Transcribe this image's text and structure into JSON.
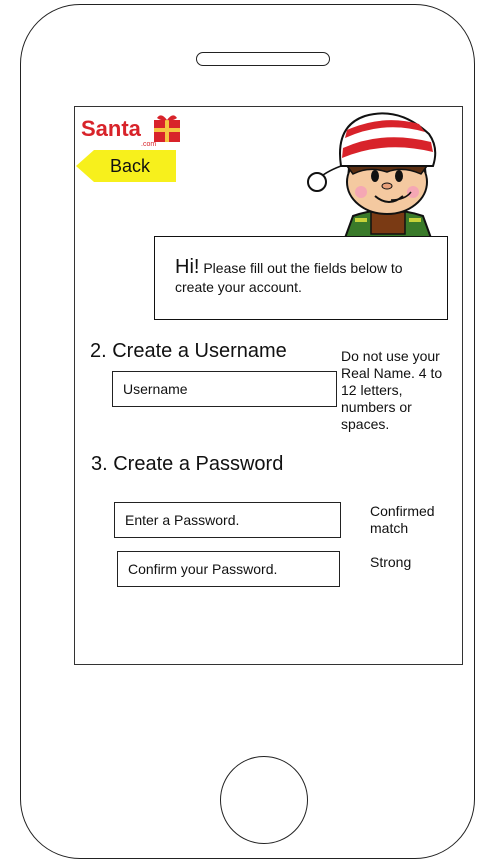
{
  "header": {
    "logo_text": "Santa",
    "logo_sub": ".com",
    "back_label": "Back"
  },
  "bubble": {
    "greeting": "Hi!",
    "message": "Please fill out the fields below to create your account."
  },
  "username_section": {
    "heading": "2. Create a Username",
    "input_placeholder": "Username",
    "hint": "Do not use your Real Name. 4 to 12 letters, numbers or spaces."
  },
  "password_section": {
    "heading": "3. Create a Password",
    "password_placeholder": "Enter a Password.",
    "confirm_placeholder": "Confirm your Password.",
    "match_status": "Confirmed match",
    "strength_status": "Strong"
  },
  "colors": {
    "brand_red": "#d8232a",
    "back_yellow": "#f7f01c"
  }
}
